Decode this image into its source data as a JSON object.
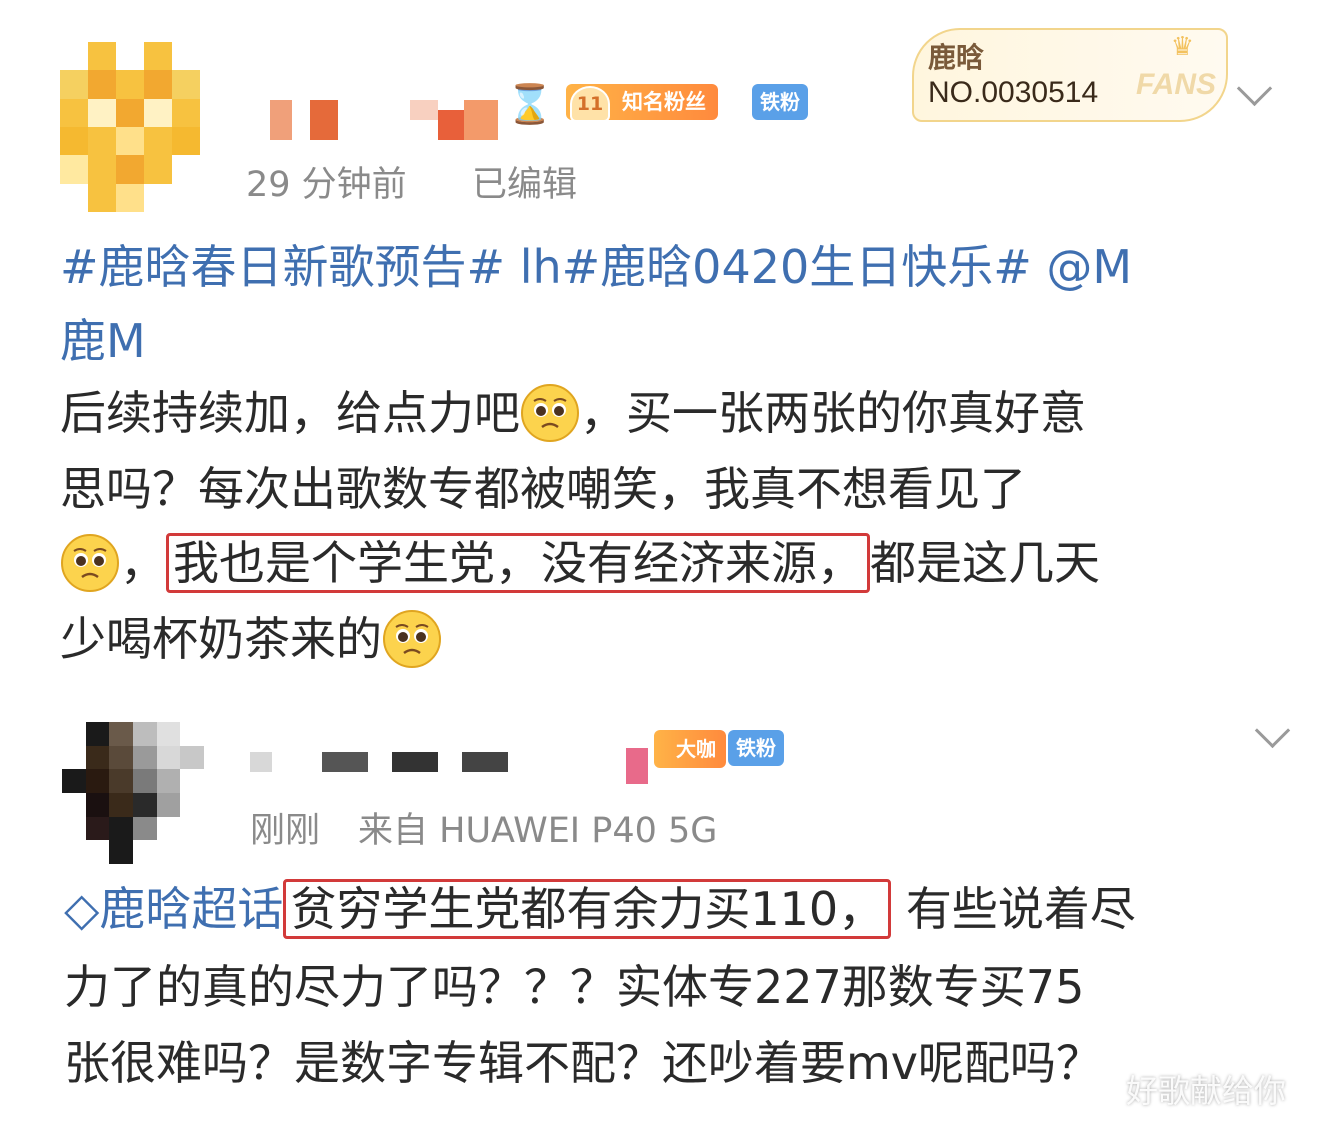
{
  "post1": {
    "time": "29 分钟前",
    "edited": "已编辑",
    "fan_level": "11",
    "fan_badge": "知名粉丝",
    "iron_badge": "铁粉",
    "fans_card": {
      "name": "鹿晗",
      "number": "NO.0030514",
      "word": "FANS"
    },
    "lines": {
      "l1": "#鹿晗春日新歌预告# lh#鹿晗0420生日快乐# @M",
      "l2": "鹿M",
      "l3a": "后续持续加，给点力吧",
      "l3b": "，买一张两张的你真好意",
      "l4": "思吗？每次出歌数专都被嘲笑，我真不想看见了",
      "l5a": "，",
      "l5_highlight": "我也是个学生党，没有经济来源，",
      "l5b": "都是这几天",
      "l6": "少喝杯奶茶来的"
    }
  },
  "post2": {
    "time": "刚刚",
    "source": "来自 HUAWEI P40 5G",
    "big_badge": "大咖",
    "iron_badge": "铁粉",
    "lines": {
      "supertopic": "鹿晗超话",
      "l1_highlight": "贫穷学生党都有余力买110，",
      "l1b": "有些说着尽",
      "l2": "力了的真的尽力了吗？？？实体专227那数专买75",
      "l3": "张很难吗？是数字专辑不配？还吵着要mv呢配吗？"
    }
  },
  "watermark": "好歌献给你"
}
